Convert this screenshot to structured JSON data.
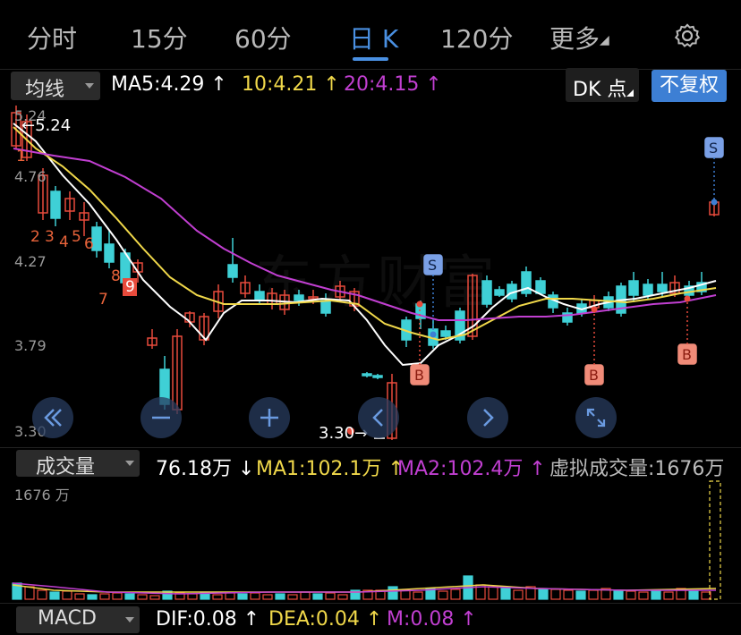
{
  "tabs": [
    {
      "label": "分时"
    },
    {
      "label": "15分"
    },
    {
      "label": "60分"
    },
    {
      "label": "日 K"
    },
    {
      "label": "120分"
    },
    {
      "label": "更多"
    }
  ],
  "ma_bar": {
    "selector": "均线",
    "ma5": "MA5:4.29",
    "ma10": "10:4.21",
    "ma20": "20:4.15",
    "dk_label": "DK 点",
    "fq_label": "不复权"
  },
  "price_axis": {
    "top": "5.24",
    "l2": "4.76",
    "l3": "4.27",
    "l4": "3.79",
    "bottom": "3.30"
  },
  "annotations": {
    "high_label": "←5.24",
    "low_label": "3.30→",
    "td_numbers": [
      "1",
      "2",
      "3",
      "4",
      "5",
      "6",
      "7",
      "8",
      "9"
    ],
    "b_marker": "B",
    "s_marker": "S"
  },
  "volume_bar": {
    "selector": "成交量",
    "vol": "76.18万",
    "ma1": "MA1:102.1万",
    "ma2": "MA2:102.4万",
    "virtual": "虚拟成交量:1676万",
    "axis_max": "1676 万"
  },
  "macd_bar": {
    "selector": "MACD",
    "dif": "DIF:0.08",
    "dea": "DEA:0.04",
    "m": "M:0.08"
  },
  "watermark": "东方财富",
  "colors": {
    "up": "#e84b3c",
    "down": "#3fd0d6",
    "ma5": "#ffffff",
    "ma10": "#f0d84a",
    "ma20": "#c13fd1",
    "accent": "#4a90e2"
  }
}
